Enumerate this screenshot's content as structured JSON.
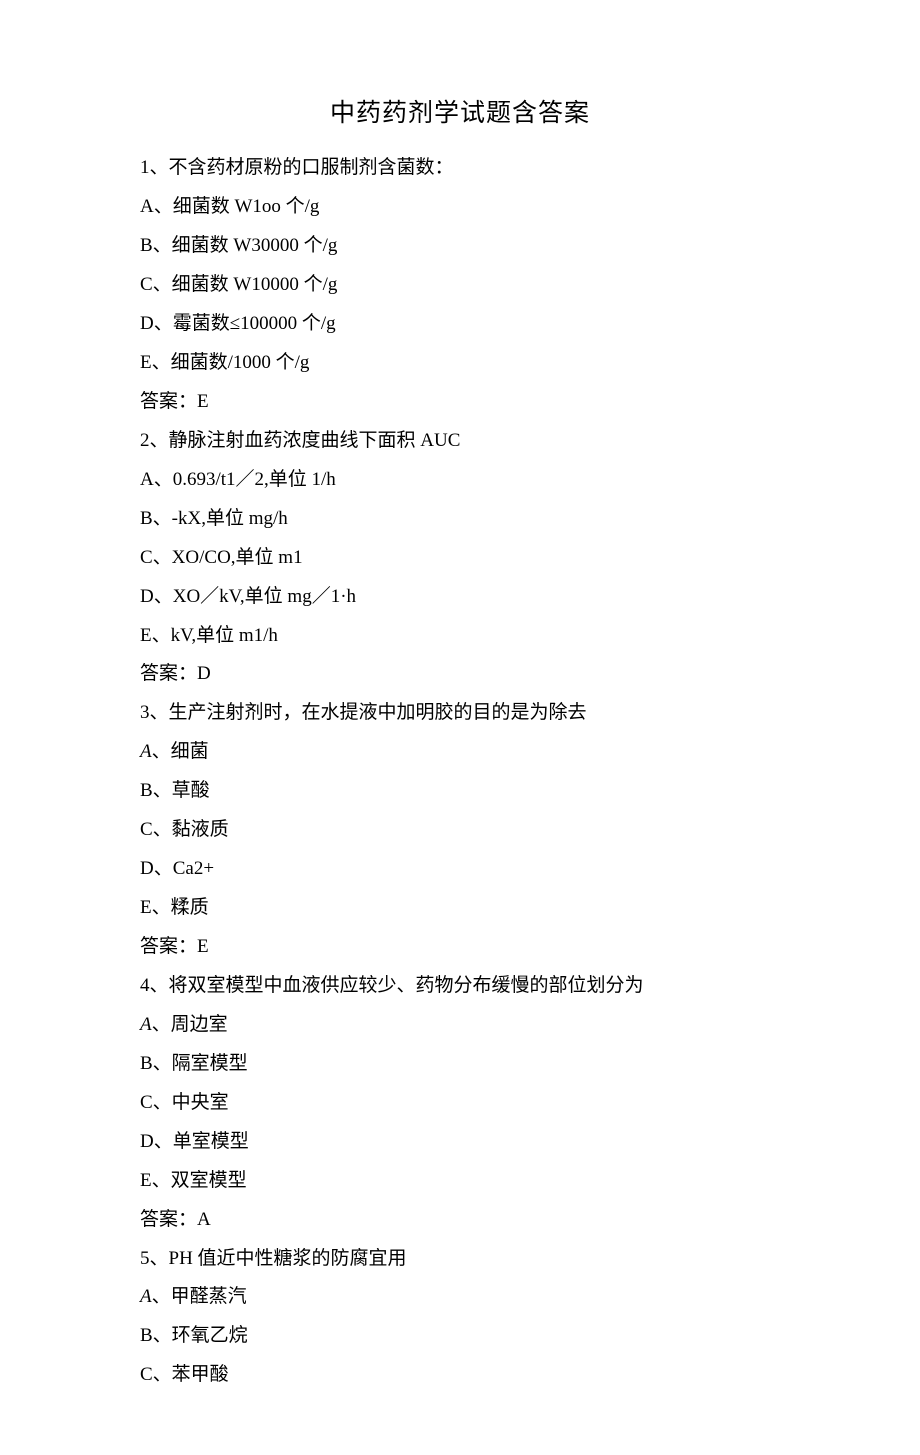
{
  "title": "中药药剂学试题含答案",
  "questions": [
    {
      "stem": "1、不含药材原粉的口服制剂含菌数：",
      "options": [
        "A、细菌数 W1oo 个/g",
        "B、细菌数 W30000 个/g",
        "C、细菌数 W10000 个/g",
        "D、霉菌数≤100000 个/g",
        "E、细菌数/1000 个/g"
      ],
      "answer": "答案：E"
    },
    {
      "stem": "2、静脉注射血药浓度曲线下面积 AUC",
      "options": [
        "A、0.693/t1／2,单位 1/h",
        "B、-kX,单位 mg/h",
        "C、XO/CO,单位 m1",
        "D、XO／kV,单位 mg／1·h",
        "E、kV,单位 m1/h"
      ],
      "answer": "答案：D"
    },
    {
      "stem": "3、生产注射剂时，在水提液中加明胶的目的是为除去",
      "options": [
        {
          "prefix": "A",
          "rest": "、细菌",
          "italic": true
        },
        "B、草酸",
        "C、黏液质",
        "D、Ca2+",
        "E、糅质"
      ],
      "answer": "答案：E"
    },
    {
      "stem": "4、将双室模型中血液供应较少、药物分布缓慢的部位划分为",
      "options": [
        {
          "prefix": "A",
          "rest": "、周边室",
          "italic": true
        },
        "B、隔室模型",
        "C、中央室",
        "D、单室模型",
        "E、双室模型"
      ],
      "answer": "答案：A"
    },
    {
      "stem": "5、PH 值近中性糖浆的防腐宜用",
      "options": [
        {
          "prefix": "A",
          "rest": "、甲醛蒸汽",
          "italic": true
        },
        "B、环氧乙烷",
        "C、苯甲酸"
      ],
      "answer": null
    }
  ]
}
